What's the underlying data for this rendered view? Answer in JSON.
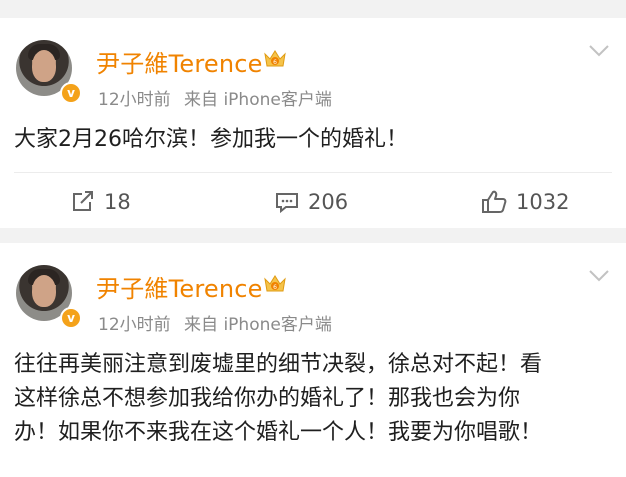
{
  "posts": [
    {
      "author": "尹子維Terence",
      "time": "12小时前",
      "source": "来自 iPhone客户端",
      "content": "大家2月26哈尔滨！参加我一个的婚礼！",
      "reposts": "18",
      "comments": "206",
      "likes": "1032",
      "icons": [
        "repost-icon",
        "comment-icon",
        "like-icon"
      ]
    },
    {
      "author": "尹子維Terence",
      "time": "12小时前",
      "source": "来自 iPhone客户端",
      "content_lines": [
        "往往再美丽注意到废墟里的细节决裂，徐总对不起！看",
        "这样徐总不想参加我给你办的婚礼了！那我也会为你",
        "办！如果你不来我在这个婚礼一个人！我要为你唱歌！"
      ]
    }
  ],
  "colors": {
    "name": "#f08300",
    "verified": "#f4a21a",
    "meta": "#8a8a8a",
    "text": "#1f1f1f"
  }
}
